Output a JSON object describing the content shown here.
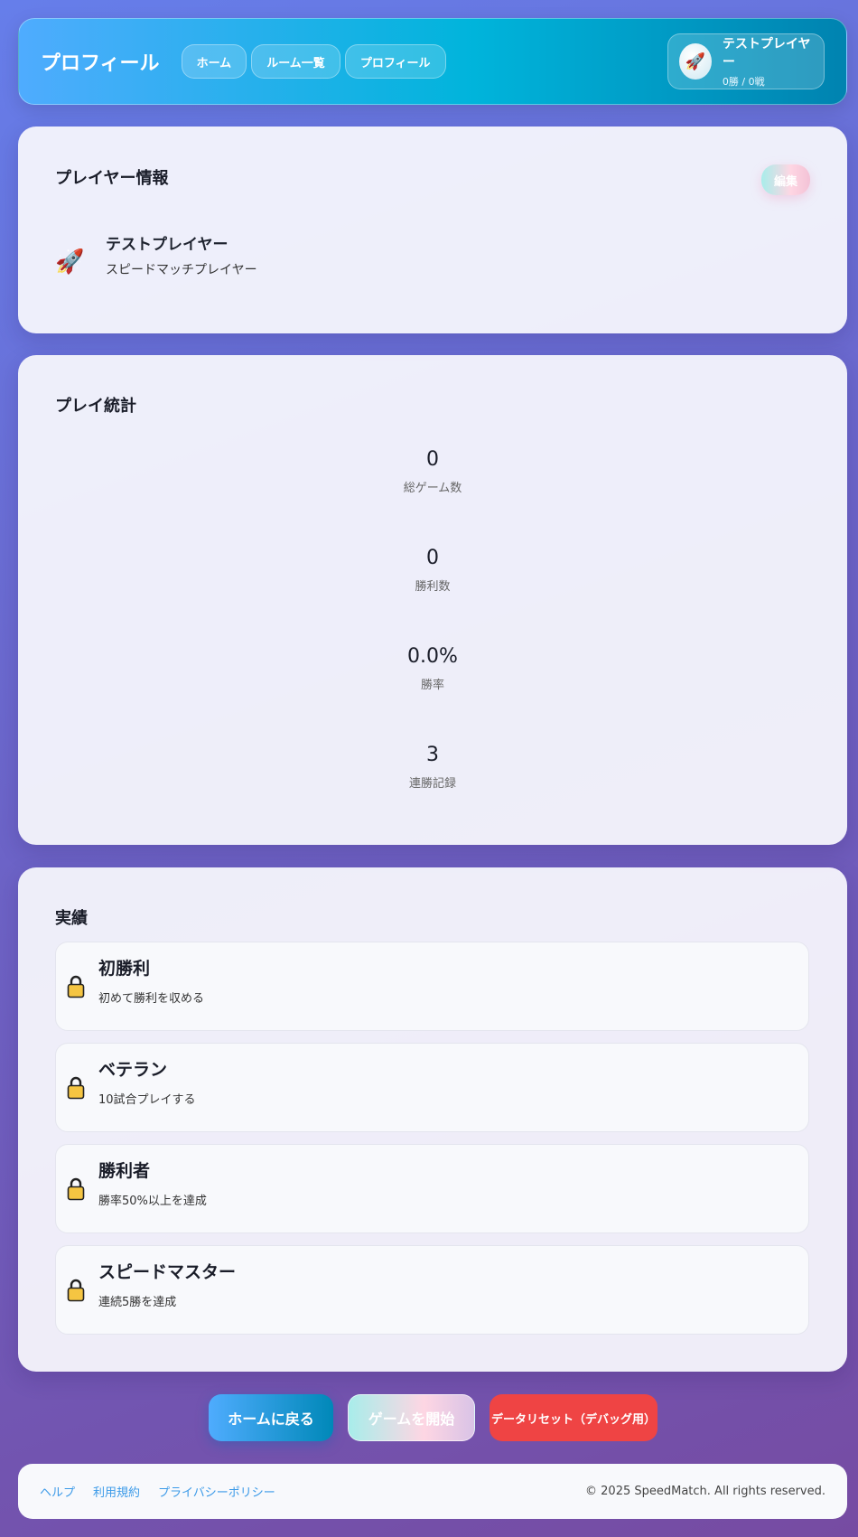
{
  "header": {
    "title": "プロフィール",
    "nav": [
      {
        "label": "ホーム"
      },
      {
        "label": "ルーム一覧"
      },
      {
        "label": "プロフィール"
      }
    ],
    "user": {
      "avatar": "🚀",
      "name": "テストプレイヤー",
      "record": "0勝 / 0戦"
    }
  },
  "player_info": {
    "title": "プレイヤー情報",
    "edit_label": "編集",
    "avatar": "🚀",
    "name": "テストプレイヤー",
    "subtitle": "スピードマッチプレイヤー"
  },
  "stats": {
    "title": "プレイ統計",
    "items": [
      {
        "value": "0",
        "label": "総ゲーム数"
      },
      {
        "value": "0",
        "label": "勝利数"
      },
      {
        "value": "0.0%",
        "label": "勝率"
      },
      {
        "value": "3",
        "label": "連勝記録"
      }
    ]
  },
  "achievements": {
    "title": "実績",
    "icon": "lock-icon",
    "items": [
      {
        "title": "初勝利",
        "desc": "初めて勝利を収める"
      },
      {
        "title": "ベテラン",
        "desc": "10試合プレイする"
      },
      {
        "title": "勝利者",
        "desc": "勝率50%以上を達成"
      },
      {
        "title": "スピードマスター",
        "desc": "連続5勝を達成"
      }
    ]
  },
  "actions": {
    "home": "ホームに戻る",
    "start": "ゲームを開始",
    "reset": "データリセット（デバッグ用）"
  },
  "footer": {
    "links": [
      {
        "label": "ヘルプ"
      },
      {
        "label": "利用規約"
      },
      {
        "label": "プライバシーポリシー"
      }
    ],
    "copyright": "© 2025 SpeedMatch. All rights reserved."
  }
}
